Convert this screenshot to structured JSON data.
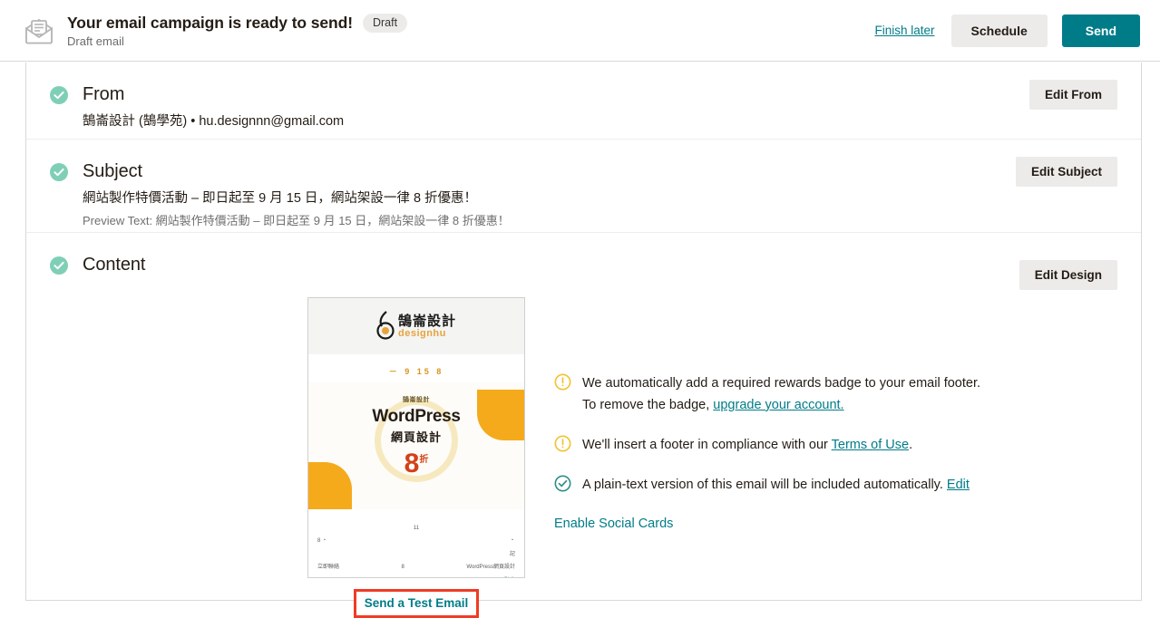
{
  "header": {
    "icon": "open-envelope-icon",
    "title": "Your email campaign is ready to send!",
    "badge": "Draft",
    "subtitle": "Draft email",
    "finish_later": "Finish later",
    "schedule": "Schedule",
    "send": "Send"
  },
  "sections": {
    "from": {
      "title": "From",
      "value": "鵠崙設計 (鵠學苑) • hu.designnn@gmail.com",
      "edit_label": "Edit From"
    },
    "subject": {
      "title": "Subject",
      "value": "網站製作特價活動 – 即日起至 9 月 15 日，網站架設一律 8 折優惠！",
      "preview_text": "Preview Text: 網站製作特價活動 – 即日起至 9 月 15 日，網站架設一律 8 折優惠！",
      "edit_label": "Edit Subject"
    },
    "content": {
      "title": "Content",
      "edit_label": "Edit Design",
      "test_email_label": "Send a Test Email",
      "preview": {
        "logo_cn": "鵠崙設計",
        "logo_en": "designhu",
        "date_line": "－ 9 15 8",
        "hero_brand": "鵠崙設計",
        "hero_title": "WordPress",
        "hero_subtitle": "網頁設計",
        "hero_number": "8",
        "hero_unit": "折",
        "body_center_1": "11",
        "body_left_1": "8 ・",
        "body_right_1": "・",
        "body_right_2": "記",
        "body_left_2": "立即聯絡",
        "body_center_2": "8",
        "body_right_3": "WordPress網頁設計",
        "body_right_link": "點此"
      }
    }
  },
  "notices": [
    {
      "icon": "warning-circle-icon",
      "text_before": "We automatically add a required rewards badge to your email footer. To remove the badge, ",
      "link": "upgrade your account.",
      "text_after": ""
    },
    {
      "icon": "warning-circle-icon",
      "text_before": "We'll insert a footer in compliance with our ",
      "link": "Terms of Use",
      "text_after": "."
    },
    {
      "icon": "check-circle-icon",
      "text_before": "A plain-text version of this email will be included automatically. ",
      "link": "Edit",
      "text_after": ""
    }
  ],
  "social_cards_link": "Enable Social Cards",
  "colors": {
    "accent": "#007c89",
    "check": "#7fcfb6",
    "warning": "#f2c230",
    "highlight": "#ef3b24",
    "button_bg": "#ecebe9"
  }
}
